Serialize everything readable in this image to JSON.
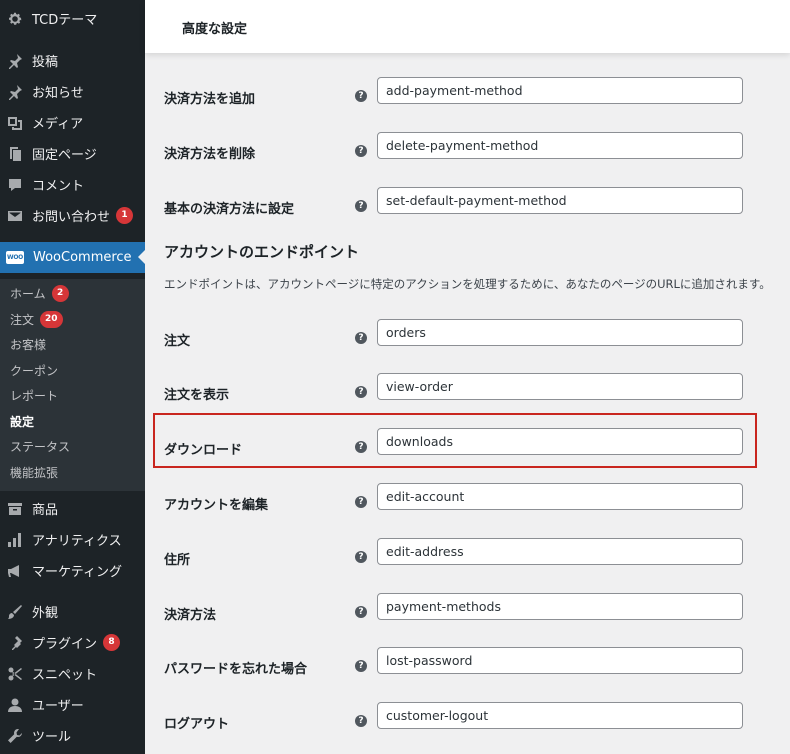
{
  "sidebar": {
    "items": [
      {
        "label": "TCDテーマ",
        "icon": "gear-icon"
      },
      {
        "label": "投稿",
        "icon": "pin-icon"
      },
      {
        "label": "お知らせ",
        "icon": "pin-icon"
      },
      {
        "label": "メディア",
        "icon": "media-icon"
      },
      {
        "label": "固定ページ",
        "icon": "page-icon"
      },
      {
        "label": "コメント",
        "icon": "comment-icon"
      },
      {
        "label": "お問い合わせ",
        "icon": "mail-icon",
        "badge": "1"
      },
      {
        "label": "WooCommerce",
        "icon": "woocommerce-icon"
      },
      {
        "label": "商品",
        "icon": "archive-icon"
      },
      {
        "label": "アナリティクス",
        "icon": "bar-chart-icon"
      },
      {
        "label": "マーケティング",
        "icon": "megaphone-icon"
      },
      {
        "label": "外観",
        "icon": "paintbrush-icon"
      },
      {
        "label": "プラグイン",
        "icon": "plugin-icon",
        "badge": "8"
      },
      {
        "label": "スニペット",
        "icon": "scissors-icon"
      },
      {
        "label": "ユーザー",
        "icon": "user-icon"
      },
      {
        "label": "ツール",
        "icon": "wrench-icon"
      }
    ],
    "woo_logo_text": "WOO",
    "submenu": [
      {
        "label": "ホーム",
        "badge": "2"
      },
      {
        "label": "注文",
        "badge": "20"
      },
      {
        "label": "お客様"
      },
      {
        "label": "クーポン"
      },
      {
        "label": "レポート"
      },
      {
        "label": "設定",
        "current": true
      },
      {
        "label": "ステータス"
      },
      {
        "label": "機能拡張"
      }
    ]
  },
  "header": {
    "title": "高度な設定"
  },
  "payment_rows": [
    {
      "label": "決済方法を追加",
      "value": "add-payment-method"
    },
    {
      "label": "決済方法を削除",
      "value": "delete-payment-method"
    },
    {
      "label": "基本の決済方法に設定",
      "value": "set-default-payment-method"
    }
  ],
  "section": {
    "title": "アカウントのエンドポイント",
    "description": "エンドポイントは、アカウントページに特定のアクションを処理するために、あなたのページのURLに追加されます。"
  },
  "endpoint_rows": [
    {
      "label": "注文",
      "value": "orders"
    },
    {
      "label": "注文を表示",
      "value": "view-order"
    },
    {
      "label": "ダウンロード",
      "value": "downloads",
      "highlighted": true
    },
    {
      "label": "アカウントを編集",
      "value": "edit-account"
    },
    {
      "label": "住所",
      "value": "edit-address"
    },
    {
      "label": "決済方法",
      "value": "payment-methods"
    },
    {
      "label": "パスワードを忘れた場合",
      "value": "lost-password"
    },
    {
      "label": "ログアウト",
      "value": "customer-logout"
    }
  ],
  "help_glyph": "?",
  "colors": {
    "sidebar_bg": "#1d2327",
    "accent": "#2271b1",
    "badge": "#d63638",
    "highlight": "#c9261f"
  }
}
